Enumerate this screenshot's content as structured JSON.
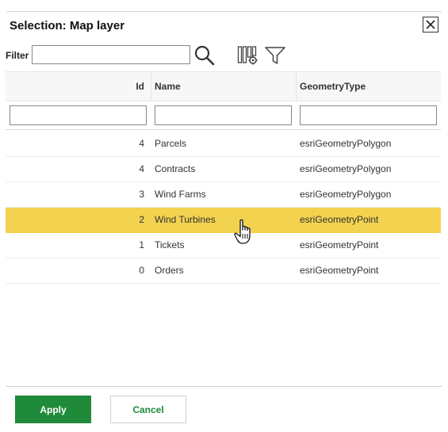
{
  "dialog": {
    "title": "Selection: Map layer"
  },
  "toolbar": {
    "filter_label": "Filter",
    "filter_value": "",
    "search_icon": "search-icon",
    "columns_icon": "column-settings-icon",
    "filter_icon": "funnel-icon"
  },
  "grid": {
    "columns": [
      "Id",
      "Name",
      "GeometryType"
    ],
    "column_filters": [
      "",
      "",
      ""
    ],
    "rows": [
      {
        "id": "4",
        "name": "Parcels",
        "geometry": "esriGeometryPolygon",
        "selected": false
      },
      {
        "id": "4",
        "name": "Contracts",
        "geometry": "esriGeometryPolygon",
        "selected": false
      },
      {
        "id": "3",
        "name": "Wind Farms",
        "geometry": "esriGeometryPolygon",
        "selected": false
      },
      {
        "id": "2",
        "name": "Wind Turbines",
        "geometry": "esriGeometryPoint",
        "selected": true
      },
      {
        "id": "1",
        "name": "Tickets",
        "geometry": "esriGeometryPoint",
        "selected": false
      },
      {
        "id": "0",
        "name": "Orders",
        "geometry": "esriGeometryPoint",
        "selected": false
      }
    ]
  },
  "footer": {
    "apply_label": "Apply",
    "cancel_label": "Cancel"
  },
  "colors": {
    "accent": "#1f8a3a",
    "selected_row": "#f3d250"
  }
}
